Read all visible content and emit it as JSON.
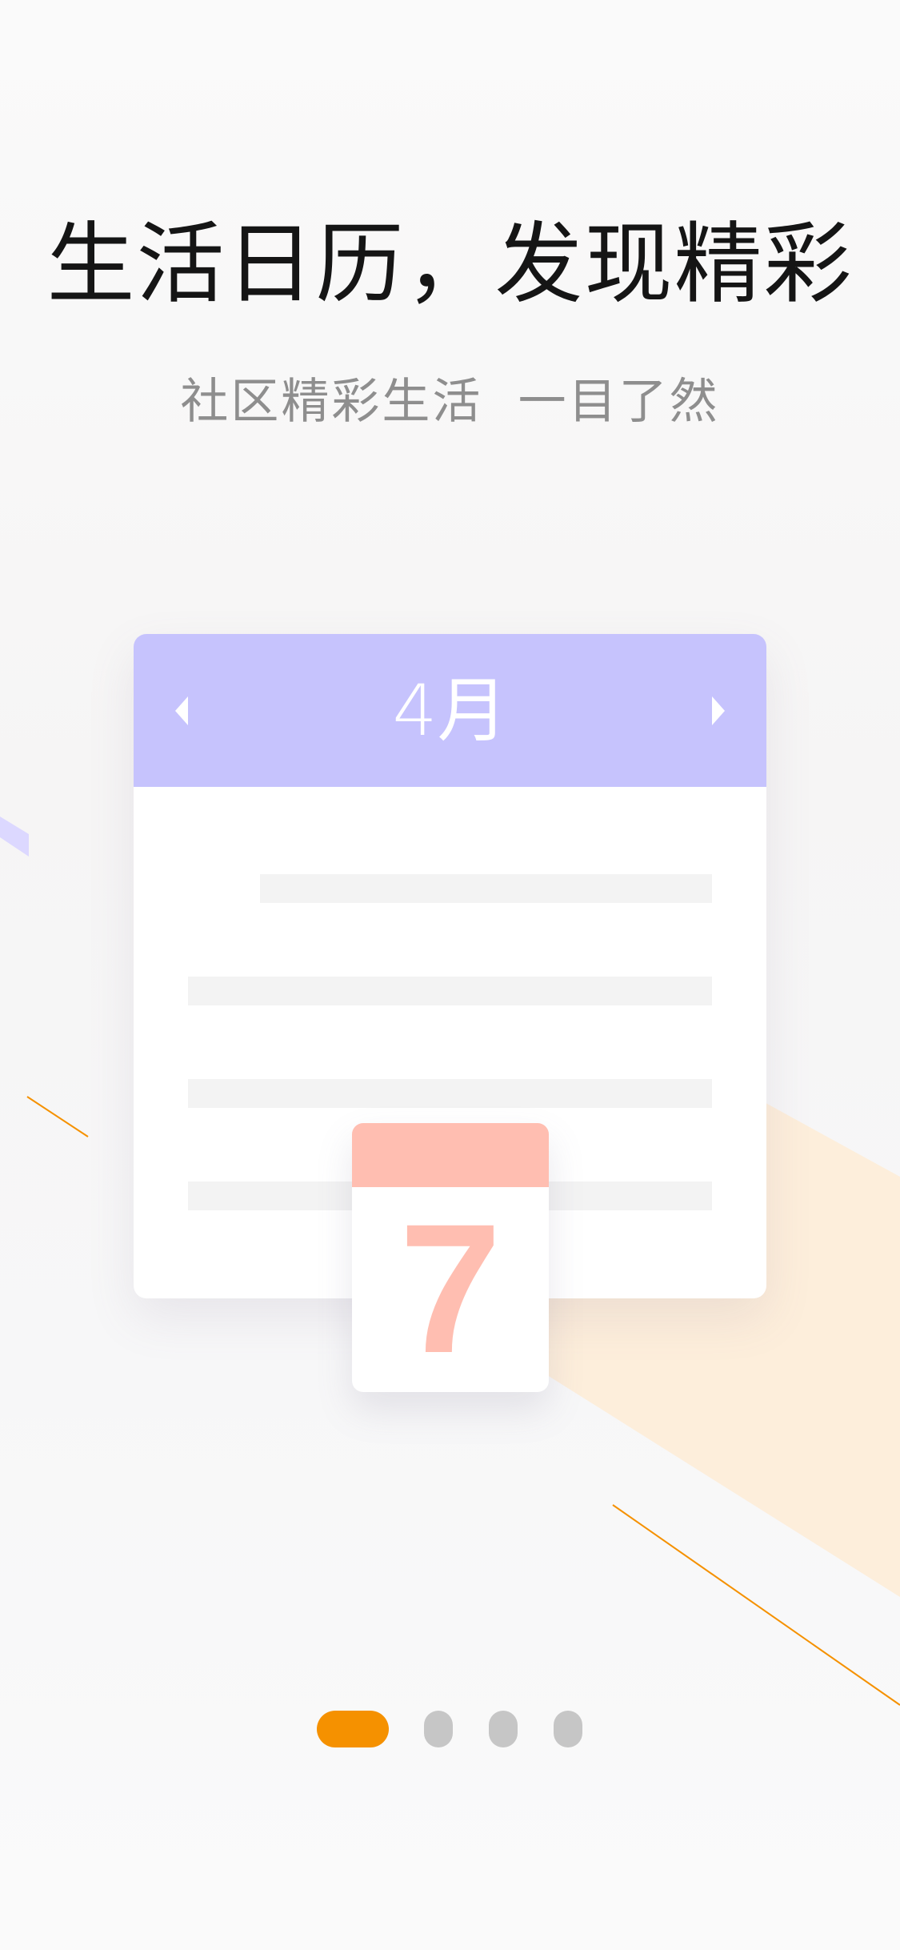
{
  "onboarding": {
    "title": "生活日历，发现精彩",
    "subtitle": "社区精彩生活  一目了然"
  },
  "calendar": {
    "month_label": "4月",
    "prev_icon": "triangle-left-icon",
    "next_icon": "triangle-right-icon",
    "date_number": "7"
  },
  "pager": {
    "total_pages": 4,
    "active_index": 0
  },
  "colors": {
    "accent": "#f59100",
    "calendar_header": "#c6c3fd",
    "date_tile_accent": "#ffbeb1",
    "inactive_dot": "#c6c6c6",
    "peach_band": "#fdeedb"
  }
}
